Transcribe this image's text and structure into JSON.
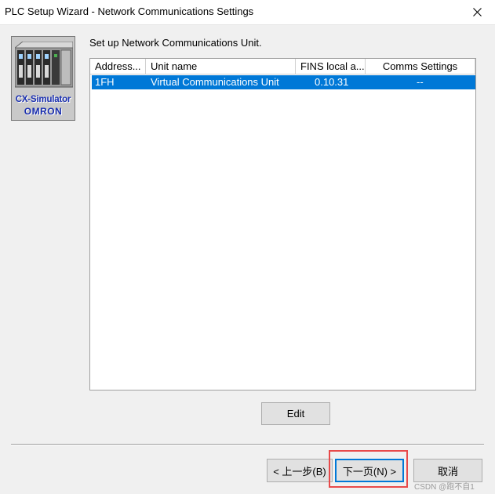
{
  "window": {
    "title": "PLC Setup Wizard - Network Communications Settings"
  },
  "logo": {
    "product": "CX-Simulator",
    "brand": "OMRON"
  },
  "instruction": "Set up Network Communications Unit.",
  "list": {
    "columns": [
      "Address...",
      "Unit name",
      "FINS local a...",
      "Comms Settings"
    ],
    "rows": [
      {
        "address": "1FH",
        "unit_name": "Virtual Communications Unit",
        "fins_local": "0.10.31",
        "comms_settings": "--"
      }
    ],
    "selected_row": 0
  },
  "buttons": {
    "edit": "Edit",
    "back": "< 上一步(B)",
    "next": "下一页(N) >",
    "cancel": "取消"
  },
  "watermark": "CSDN @跑不自1",
  "colors": {
    "selection": "#0078d7",
    "highlight_box": "#e84a4a",
    "logo_text": "#1a2fb0"
  }
}
